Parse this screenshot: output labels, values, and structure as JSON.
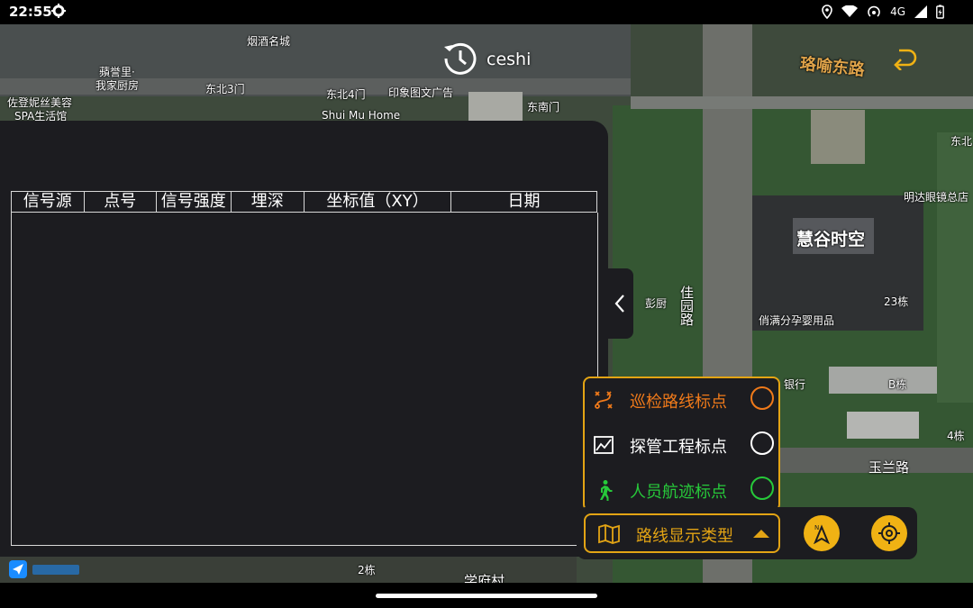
{
  "status_bar": {
    "time": "22:55",
    "network": "4G"
  },
  "header": {
    "title": "ceshi"
  },
  "map": {
    "labels": [
      {
        "text": "烟酒名城"
      },
      {
        "text": "蘋誉里·"
      },
      {
        "text": "我家厨房"
      },
      {
        "text": "东北3门"
      },
      {
        "text": "佐登妮丝美容"
      },
      {
        "text": "SPA生活馆"
      },
      {
        "text": "东北4门"
      },
      {
        "text": "印象图文广告"
      },
      {
        "text": "Shui Mu Home"
      },
      {
        "text": "东南门"
      },
      {
        "text": "东北"
      },
      {
        "text": "明达眼镜总店"
      },
      {
        "text": "彭厨"
      },
      {
        "text": "23栋"
      },
      {
        "text": "俏满分孕婴用品"
      },
      {
        "text": "银行"
      },
      {
        "text": "B栋"
      },
      {
        "text": "4栋"
      },
      {
        "text": "玉兰路"
      },
      {
        "text": "2栋"
      },
      {
        "text": "学府村"
      }
    ],
    "big_label": "慧谷时空",
    "road_labels": {
      "east_road": "珞喻东路",
      "garden_road": "佳园路"
    }
  },
  "table": {
    "columns": [
      "信号源",
      "点号",
      "信号强度",
      "埋深",
      "坐标值（XY）",
      "日期"
    ],
    "rows": []
  },
  "legend": {
    "items": [
      {
        "label": "巡检路线标点",
        "color": "#f07a1a"
      },
      {
        "label": "探管工程标点",
        "color": "#ffffff"
      },
      {
        "label": "人员航迹标点",
        "color": "#27c93a"
      }
    ]
  },
  "toolbar": {
    "route_type_label": "路线显示类型"
  },
  "colors": {
    "accent": "#e3a414",
    "panel": "#1c1c20",
    "fab": "#f0b214"
  }
}
